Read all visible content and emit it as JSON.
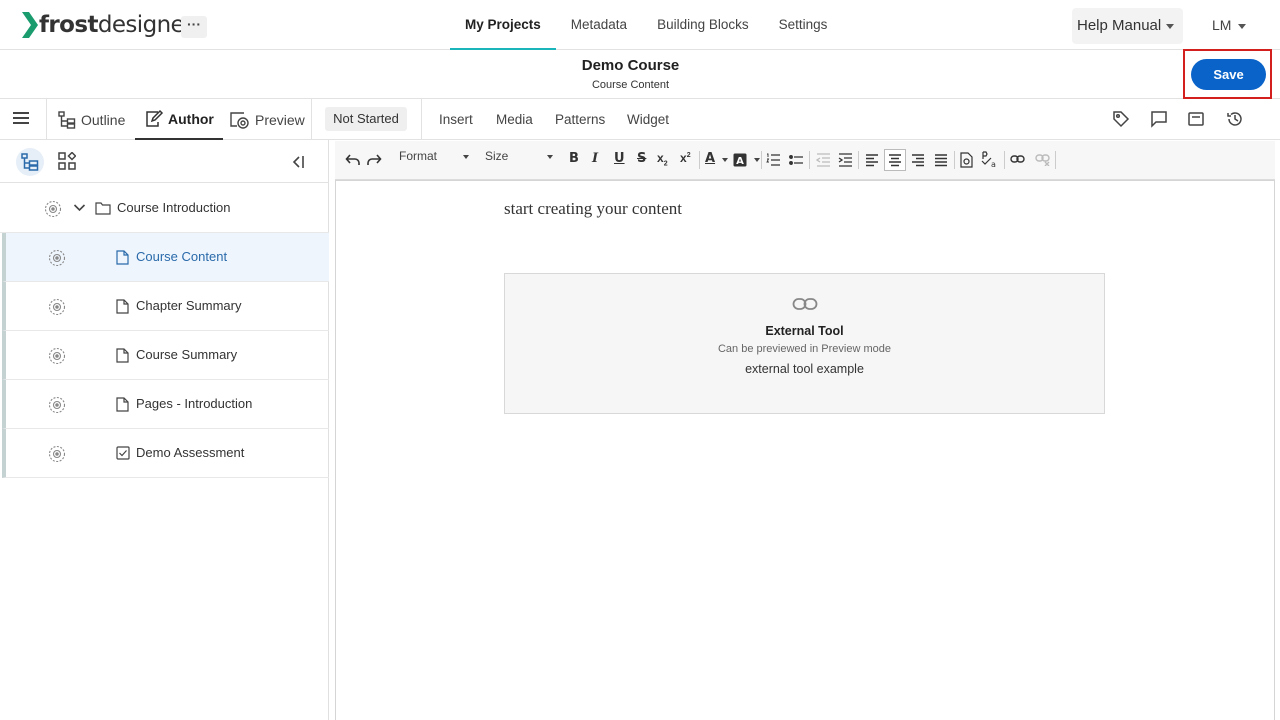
{
  "app": {
    "logo_bold": "frost",
    "logo_light": "designer",
    "logo_accent": "#1a9c6e",
    "more_label": "···"
  },
  "topnav": {
    "items": [
      {
        "label": "My Projects",
        "active": true
      },
      {
        "label": "Metadata",
        "active": false
      },
      {
        "label": "Building Blocks",
        "active": false
      },
      {
        "label": "Settings",
        "active": false
      }
    ],
    "help_label": "Help Manual",
    "user_initials": "LM"
  },
  "course": {
    "title": "Demo Course",
    "subtitle": "Course Content"
  },
  "actions": {
    "save_label": "Save",
    "save_color": "#0a63c9",
    "highlight_color": "#d41f1f"
  },
  "modes": {
    "outline": "Outline",
    "author": "Author",
    "preview": "Preview",
    "status": "Not Started",
    "insert_menu": [
      "Insert",
      "Media",
      "Patterns",
      "Widget"
    ]
  },
  "tree": {
    "items": [
      {
        "label": "Course Introduction",
        "type": "folder",
        "selected": false
      },
      {
        "label": "Course Content",
        "type": "page",
        "selected": true
      },
      {
        "label": "Chapter Summary",
        "type": "page",
        "selected": false
      },
      {
        "label": "Course Summary",
        "type": "page",
        "selected": false
      },
      {
        "label": "Pages - Introduction",
        "type": "page",
        "selected": false
      },
      {
        "label": "Demo Assessment",
        "type": "assessment",
        "selected": false
      }
    ]
  },
  "toolbar": {
    "format_label": "Format",
    "size_label": "Size"
  },
  "editor": {
    "placeholder": "start creating your content",
    "widget": {
      "title": "External Tool",
      "subtitle": "Can be previewed in Preview mode",
      "name": "external tool example"
    }
  }
}
